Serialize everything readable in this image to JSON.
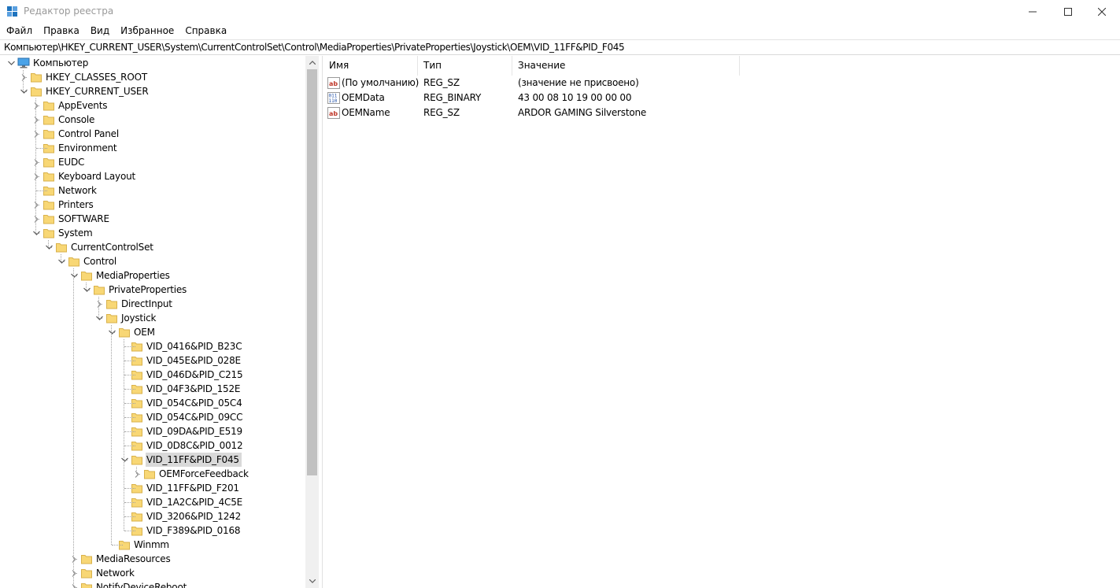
{
  "window": {
    "title": "Редактор реестра"
  },
  "menu": [
    "Файл",
    "Правка",
    "Вид",
    "Избранное",
    "Справка"
  ],
  "address": "Компьютер\\HKEY_CURRENT_USER\\System\\CurrentControlSet\\Control\\MediaProperties\\PrivateProperties\\Joystick\\OEM\\VID_11FF&PID_F045",
  "tree": [
    {
      "label": "Компьютер",
      "level": 0,
      "state": "expanded",
      "icon": "computer-icon"
    },
    {
      "label": "HKEY_CLASSES_ROOT",
      "level": 1,
      "state": "collapsed"
    },
    {
      "label": "HKEY_CURRENT_USER",
      "level": 1,
      "state": "expanded"
    },
    {
      "label": "AppEvents",
      "level": 2,
      "state": "collapsed"
    },
    {
      "label": "Console",
      "level": 2,
      "state": "collapsed"
    },
    {
      "label": "Control Panel",
      "level": 2,
      "state": "collapsed"
    },
    {
      "label": "Environment",
      "level": 2,
      "state": "leaf"
    },
    {
      "label": "EUDC",
      "level": 2,
      "state": "collapsed"
    },
    {
      "label": "Keyboard Layout",
      "level": 2,
      "state": "collapsed"
    },
    {
      "label": "Network",
      "level": 2,
      "state": "leaf"
    },
    {
      "label": "Printers",
      "level": 2,
      "state": "collapsed"
    },
    {
      "label": "SOFTWARE",
      "level": 2,
      "state": "collapsed"
    },
    {
      "label": "System",
      "level": 2,
      "state": "expanded"
    },
    {
      "label": "CurrentControlSet",
      "level": 3,
      "state": "expanded"
    },
    {
      "label": "Control",
      "level": 4,
      "state": "expanded"
    },
    {
      "label": "MediaProperties",
      "level": 5,
      "state": "expanded"
    },
    {
      "label": "PrivateProperties",
      "level": 6,
      "state": "expanded"
    },
    {
      "label": "DirectInput",
      "level": 7,
      "state": "collapsed"
    },
    {
      "label": "Joystick",
      "level": 7,
      "state": "expanded"
    },
    {
      "label": "OEM",
      "level": 8,
      "state": "expanded"
    },
    {
      "label": "VID_0416&PID_B23C",
      "level": 9,
      "state": "leaf"
    },
    {
      "label": "VID_045E&PID_028E",
      "level": 9,
      "state": "leaf"
    },
    {
      "label": "VID_046D&PID_C215",
      "level": 9,
      "state": "leaf"
    },
    {
      "label": "VID_04F3&PID_152E",
      "level": 9,
      "state": "leaf"
    },
    {
      "label": "VID_054C&PID_05C4",
      "level": 9,
      "state": "leaf"
    },
    {
      "label": "VID_054C&PID_09CC",
      "level": 9,
      "state": "leaf"
    },
    {
      "label": "VID_09DA&PID_E519",
      "level": 9,
      "state": "leaf"
    },
    {
      "label": "VID_0D8C&PID_0012",
      "level": 9,
      "state": "leaf"
    },
    {
      "label": "VID_11FF&PID_F045",
      "level": 9,
      "state": "expanded",
      "selected": true
    },
    {
      "label": "OEMForceFeedback",
      "level": 10,
      "state": "collapsed"
    },
    {
      "label": "VID_11FF&PID_F201",
      "level": 9,
      "state": "leaf"
    },
    {
      "label": "VID_1A2C&PID_4C5E",
      "level": 9,
      "state": "leaf"
    },
    {
      "label": "VID_3206&PID_1242",
      "level": 9,
      "state": "leaf"
    },
    {
      "label": "VID_F389&PID_0168",
      "level": 9,
      "state": "leaf"
    },
    {
      "label": "Winmm",
      "level": 8,
      "state": "leaf"
    },
    {
      "label": "MediaResources",
      "level": 5,
      "state": "collapsed"
    },
    {
      "label": "Network",
      "level": 5,
      "state": "collapsed"
    },
    {
      "label": "NotifyDeviceReboot",
      "level": 5,
      "state": "collapsed"
    }
  ],
  "list": {
    "columns": [
      "Имя",
      "Тип",
      "Значение"
    ],
    "rows": [
      {
        "icon": "string-value-icon",
        "name": "(По умолчанию)",
        "type": "REG_SZ",
        "data": "(значение не присвоено)"
      },
      {
        "icon": "binary-value-icon",
        "name": "OEMData",
        "type": "REG_BINARY",
        "data": "43 00 08 10 19 00 00 00"
      },
      {
        "icon": "string-value-icon",
        "name": "OEMName",
        "type": "REG_SZ",
        "data": "ARDOR GAMING Silverstone"
      }
    ]
  },
  "colors": {
    "folder": "#f8d775",
    "selection": "#d9d9d9",
    "scroll_thumb": "#c1c1c1",
    "string_icon_red": "#c0392b",
    "binary_icon_blue": "#1f4fa8"
  }
}
